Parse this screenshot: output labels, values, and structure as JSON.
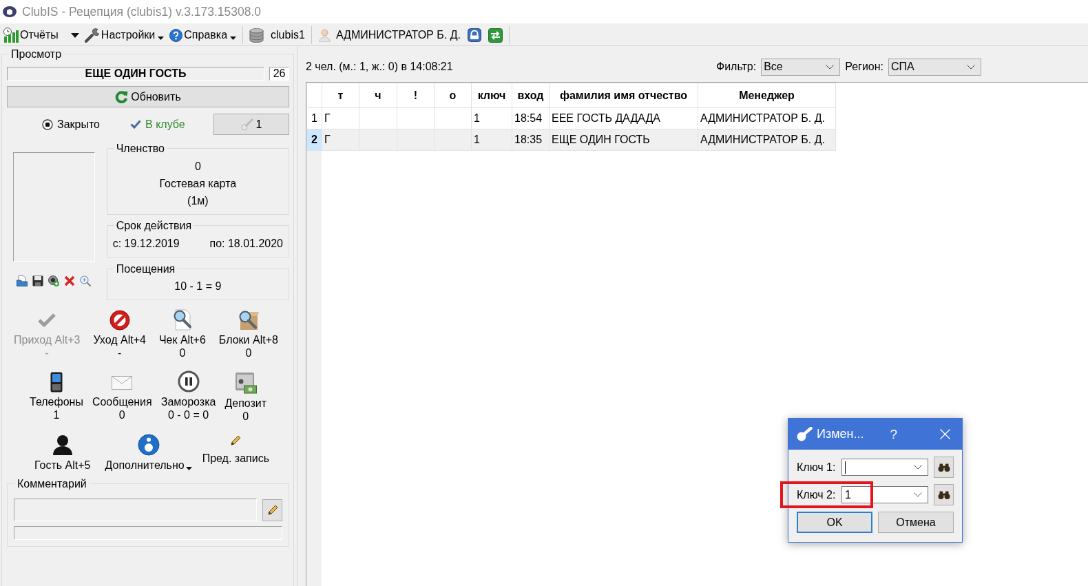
{
  "window": {
    "title": "ClubIS - Рецепция (clubis1) v.3.173.15308.0"
  },
  "toolbar": {
    "reports": "Отчёты",
    "settings": "Настройки",
    "help": "Справка",
    "database": "clubis1",
    "user": "АДМИНИСТРАТОР Б. Д."
  },
  "view_panel": {
    "title": "Просмотр",
    "guest_name": "ЕЩЕ ОДИН ГОСТЬ",
    "number": "26",
    "refresh_button": "Обновить",
    "closed": {
      "label": "Закрыто",
      "checked": true
    },
    "in_club": {
      "label": "В клубе",
      "checked": true
    },
    "key_button": "1",
    "membership": {
      "title": "Членство",
      "lines": [
        "0",
        "Гостевая карта",
        "(1м)"
      ]
    },
    "validity": {
      "title": "Срок действия",
      "from": "с: 19.12.2019",
      "to": "по: 18.01.2020"
    },
    "visits": {
      "title": "Посещения",
      "value": "10 - 1 = 9"
    },
    "action_rows": [
      {
        "items": [
          {
            "label": "Приход Alt+3",
            "value": "-",
            "disabled": true,
            "dropdown": false
          },
          {
            "label": "Уход Alt+4",
            "value": "-",
            "disabled": false,
            "dropdown": false
          },
          {
            "label": "Чек Alt+6",
            "value": "0",
            "disabled": false,
            "dropdown": false
          },
          {
            "label": "Блоки Alt+8",
            "value": "0",
            "disabled": false,
            "dropdown": false
          }
        ]
      },
      {
        "items": [
          {
            "label": "Телефоны",
            "value": "1",
            "disabled": false,
            "dropdown": false
          },
          {
            "label": "Сообщения",
            "value": "0",
            "disabled": false,
            "dropdown": false
          },
          {
            "label": "Заморозка",
            "value": "0 - 0 = 0",
            "disabled": false,
            "dropdown": false
          },
          {
            "label": "Депозит",
            "value": "0",
            "disabled": false,
            "dropdown": false
          }
        ]
      },
      {
        "items": [
          {
            "label": "Гость Alt+5",
            "disabled": false,
            "dropdown": false
          },
          {
            "label": "Дополнительно",
            "disabled": false,
            "dropdown": true
          },
          {
            "label": "Пред. запись",
            "disabled": false,
            "dropdown": false
          }
        ]
      }
    ],
    "comment": {
      "title": "Комментарий"
    }
  },
  "list_header": {
    "summary": "2 чел. (м.: 1, ж.: 0) в 14:08:21",
    "filter": {
      "label": "Фильтр:",
      "value": "Все"
    },
    "region": {
      "label": "Регион:",
      "value": "СПА"
    }
  },
  "table": {
    "columns": [
      "т",
      "ч",
      "!",
      "о",
      "ключ",
      "вход",
      "фамилия имя отчество",
      "Менеджер"
    ],
    "rows": [
      {
        "number": "1",
        "selected": false,
        "cells": [
          "Г",
          null,
          null,
          null,
          "1",
          "18:54",
          "ЕЕЕ ГОСТЬ ДАДАДА",
          "АДМИНИСТРАТОР Б. Д."
        ]
      },
      {
        "number": "2",
        "selected": true,
        "cells": [
          "Г",
          null,
          null,
          null,
          "1",
          "18:35",
          "ЕЩЕ ОДИН ГОСТЬ",
          "АДМИНИСТРАТОР Б. Д."
        ]
      }
    ]
  },
  "dialog": {
    "title": "Измен...",
    "help": "?",
    "fields": [
      {
        "label": "Ключ 1:",
        "focused": true,
        "highlighted": false
      },
      {
        "label": "Ключ 2:",
        "value": "1",
        "focused": false,
        "highlighted": true
      }
    ],
    "buttons": [
      {
        "label": "OK",
        "default": true
      },
      {
        "label": "Отмена",
        "default": false
      }
    ]
  }
}
